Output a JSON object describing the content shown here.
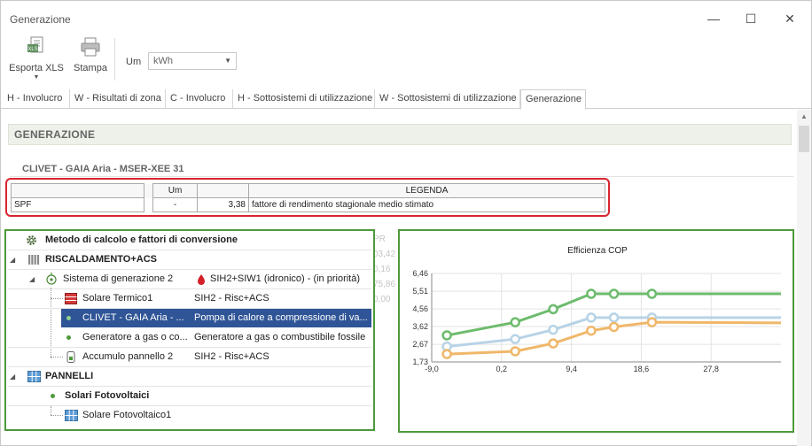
{
  "window": {
    "title": "Generazione",
    "minimize_glyph": "—",
    "maximize_glyph": "☐",
    "close_glyph": "✕"
  },
  "toolbar": {
    "export_label": "Esporta XLS",
    "print_label": "Stampa",
    "um_label": "Um",
    "um_value": "kWh"
  },
  "tabs": [
    {
      "label": "H - Involucro"
    },
    {
      "label": "W - Risultati di zona"
    },
    {
      "label": "C - Involucro"
    },
    {
      "label": "H - Sottosistemi di utilizzazione"
    },
    {
      "label": "W - Sottosistemi di utilizzazione"
    },
    {
      "label": "Generazione"
    }
  ],
  "section": {
    "title": "GENERAZIONE",
    "subtitle": "CLIVET - GAIA Aria  - MSER-XEE 31"
  },
  "spf_table": {
    "headers": [
      "",
      "Um",
      "",
      "LEGENDA"
    ],
    "row": {
      "name": "SPF",
      "um": "-",
      "value": "3,38",
      "legend": "fattore di rendimento stagionale medio stimato"
    }
  },
  "faded_col": [
    "PR",
    "03,42",
    "0,16",
    "75,86",
    "0,00"
  ],
  "tree": {
    "method_title": "Metodo di calcolo e fattori di conversione",
    "heating": "RISCALDAMENTO+ACS",
    "gen_system": {
      "name": "Sistema di generazione 2",
      "desc": "SIH2+SIW1 (idronico) - (in priorità)"
    },
    "items": [
      {
        "name": "Solare Termico1",
        "desc": "SIH2 - Risc+ACS"
      },
      {
        "name": "CLIVET - GAIA Aria - ...",
        "desc": "Pompa di calore a compressione di va..."
      },
      {
        "name": "Generatore a gas o co...",
        "desc": "Generatore a gas o combustibile fossile"
      },
      {
        "name": "Accumulo pannello 2",
        "desc": "SIH2 - Risc+ACS"
      }
    ],
    "panels": "PANNELLI",
    "pv_group": "Solari Fotovoltaici",
    "pv_item": "Solare Fotovoltaico1"
  },
  "colors": {
    "accent_green": "#4e9a3b",
    "highlight_red": "#d9242f",
    "selection_blue": "#2f5597"
  },
  "chart_data": {
    "type": "line",
    "title": "Efficienza COP",
    "xlim": [
      -9.0,
      37.0
    ],
    "ylim": [
      1.73,
      6.46
    ],
    "x_ticks": [
      -9.0,
      0.2,
      9.4,
      18.6,
      27.8
    ],
    "x_tick_labels": [
      "-9,0",
      "0,2",
      "9,4",
      "18,6",
      "27,8"
    ],
    "y_ticks": [
      1.73,
      2.67,
      3.62,
      4.56,
      5.51,
      6.46
    ],
    "y_tick_labels": [
      "1,73",
      "2,67",
      "3,62",
      "4,56",
      "5,51",
      "6,46"
    ],
    "grid": true,
    "series": [
      {
        "color": "#6dbb6d",
        "x": [
          -7,
          2,
          7,
          12,
          15,
          20
        ],
        "y": [
          3.15,
          3.85,
          4.55,
          5.37,
          5.37,
          5.37
        ],
        "line_end_x": 37,
        "line_end_y": 5.37
      },
      {
        "color": "#b8d3e6",
        "x": [
          -7,
          2,
          7,
          12,
          15,
          20
        ],
        "y": [
          2.55,
          2.95,
          3.45,
          4.1,
          4.1,
          4.1
        ],
        "line_end_x": 37,
        "line_end_y": 4.1
      },
      {
        "color": "#f0b76a",
        "x": [
          -7,
          2,
          7,
          12,
          15,
          20
        ],
        "y": [
          2.15,
          2.3,
          2.72,
          3.4,
          3.6,
          3.85
        ],
        "line_end_x": 37,
        "line_end_y": 3.82
      }
    ]
  }
}
